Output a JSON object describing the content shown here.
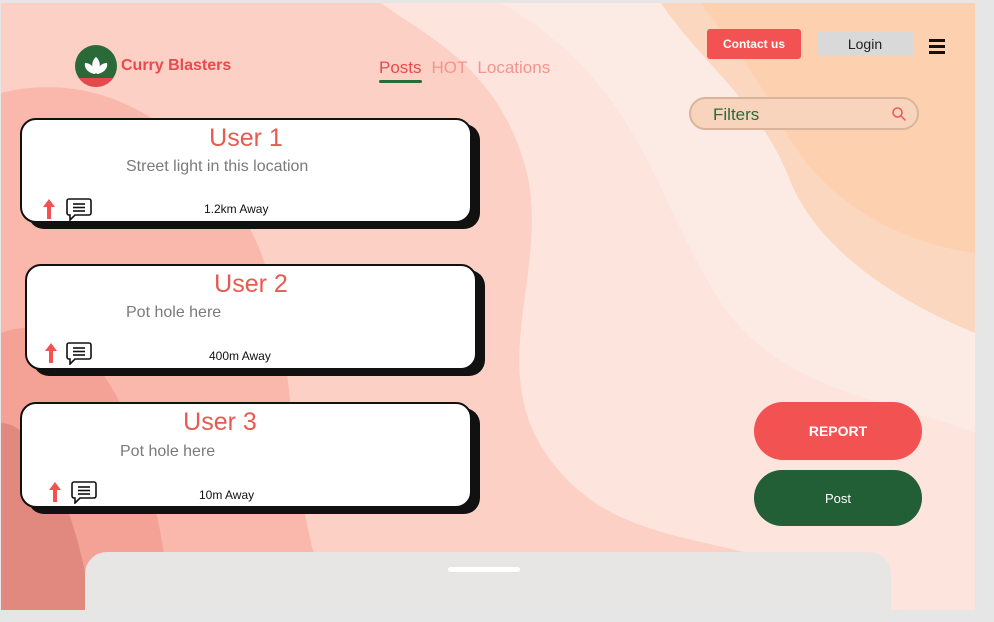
{
  "brand": {
    "name": "Curry Blasters"
  },
  "nav": {
    "tabs": [
      "Posts",
      "HOT",
      "Locations"
    ],
    "active": "Posts"
  },
  "header": {
    "contact_label": "Contact us",
    "login_label": "Login"
  },
  "filters": {
    "label": "Filters"
  },
  "posts": [
    {
      "user": "User 1",
      "text": "Street light in this location",
      "distance": "1.2km Away"
    },
    {
      "user": "User 2",
      "text": "Pot hole here",
      "distance": "400m Away"
    },
    {
      "user": "User 3",
      "text": "Pot hole here",
      "distance": "10m Away"
    }
  ],
  "actions": {
    "report_label": "REPORT",
    "post_label": "Post"
  },
  "colors": {
    "accent_red": "#f25252",
    "brand_green": "#225e36",
    "heading_red": "#e85a50",
    "nav_inactive": "#f2958e"
  },
  "icons": {
    "logo": "leaf-logo-icon",
    "menu": "hamburger-menu-icon",
    "search": "search-icon",
    "upvote": "upvote-arrow-icon",
    "comment": "comment-icon"
  }
}
